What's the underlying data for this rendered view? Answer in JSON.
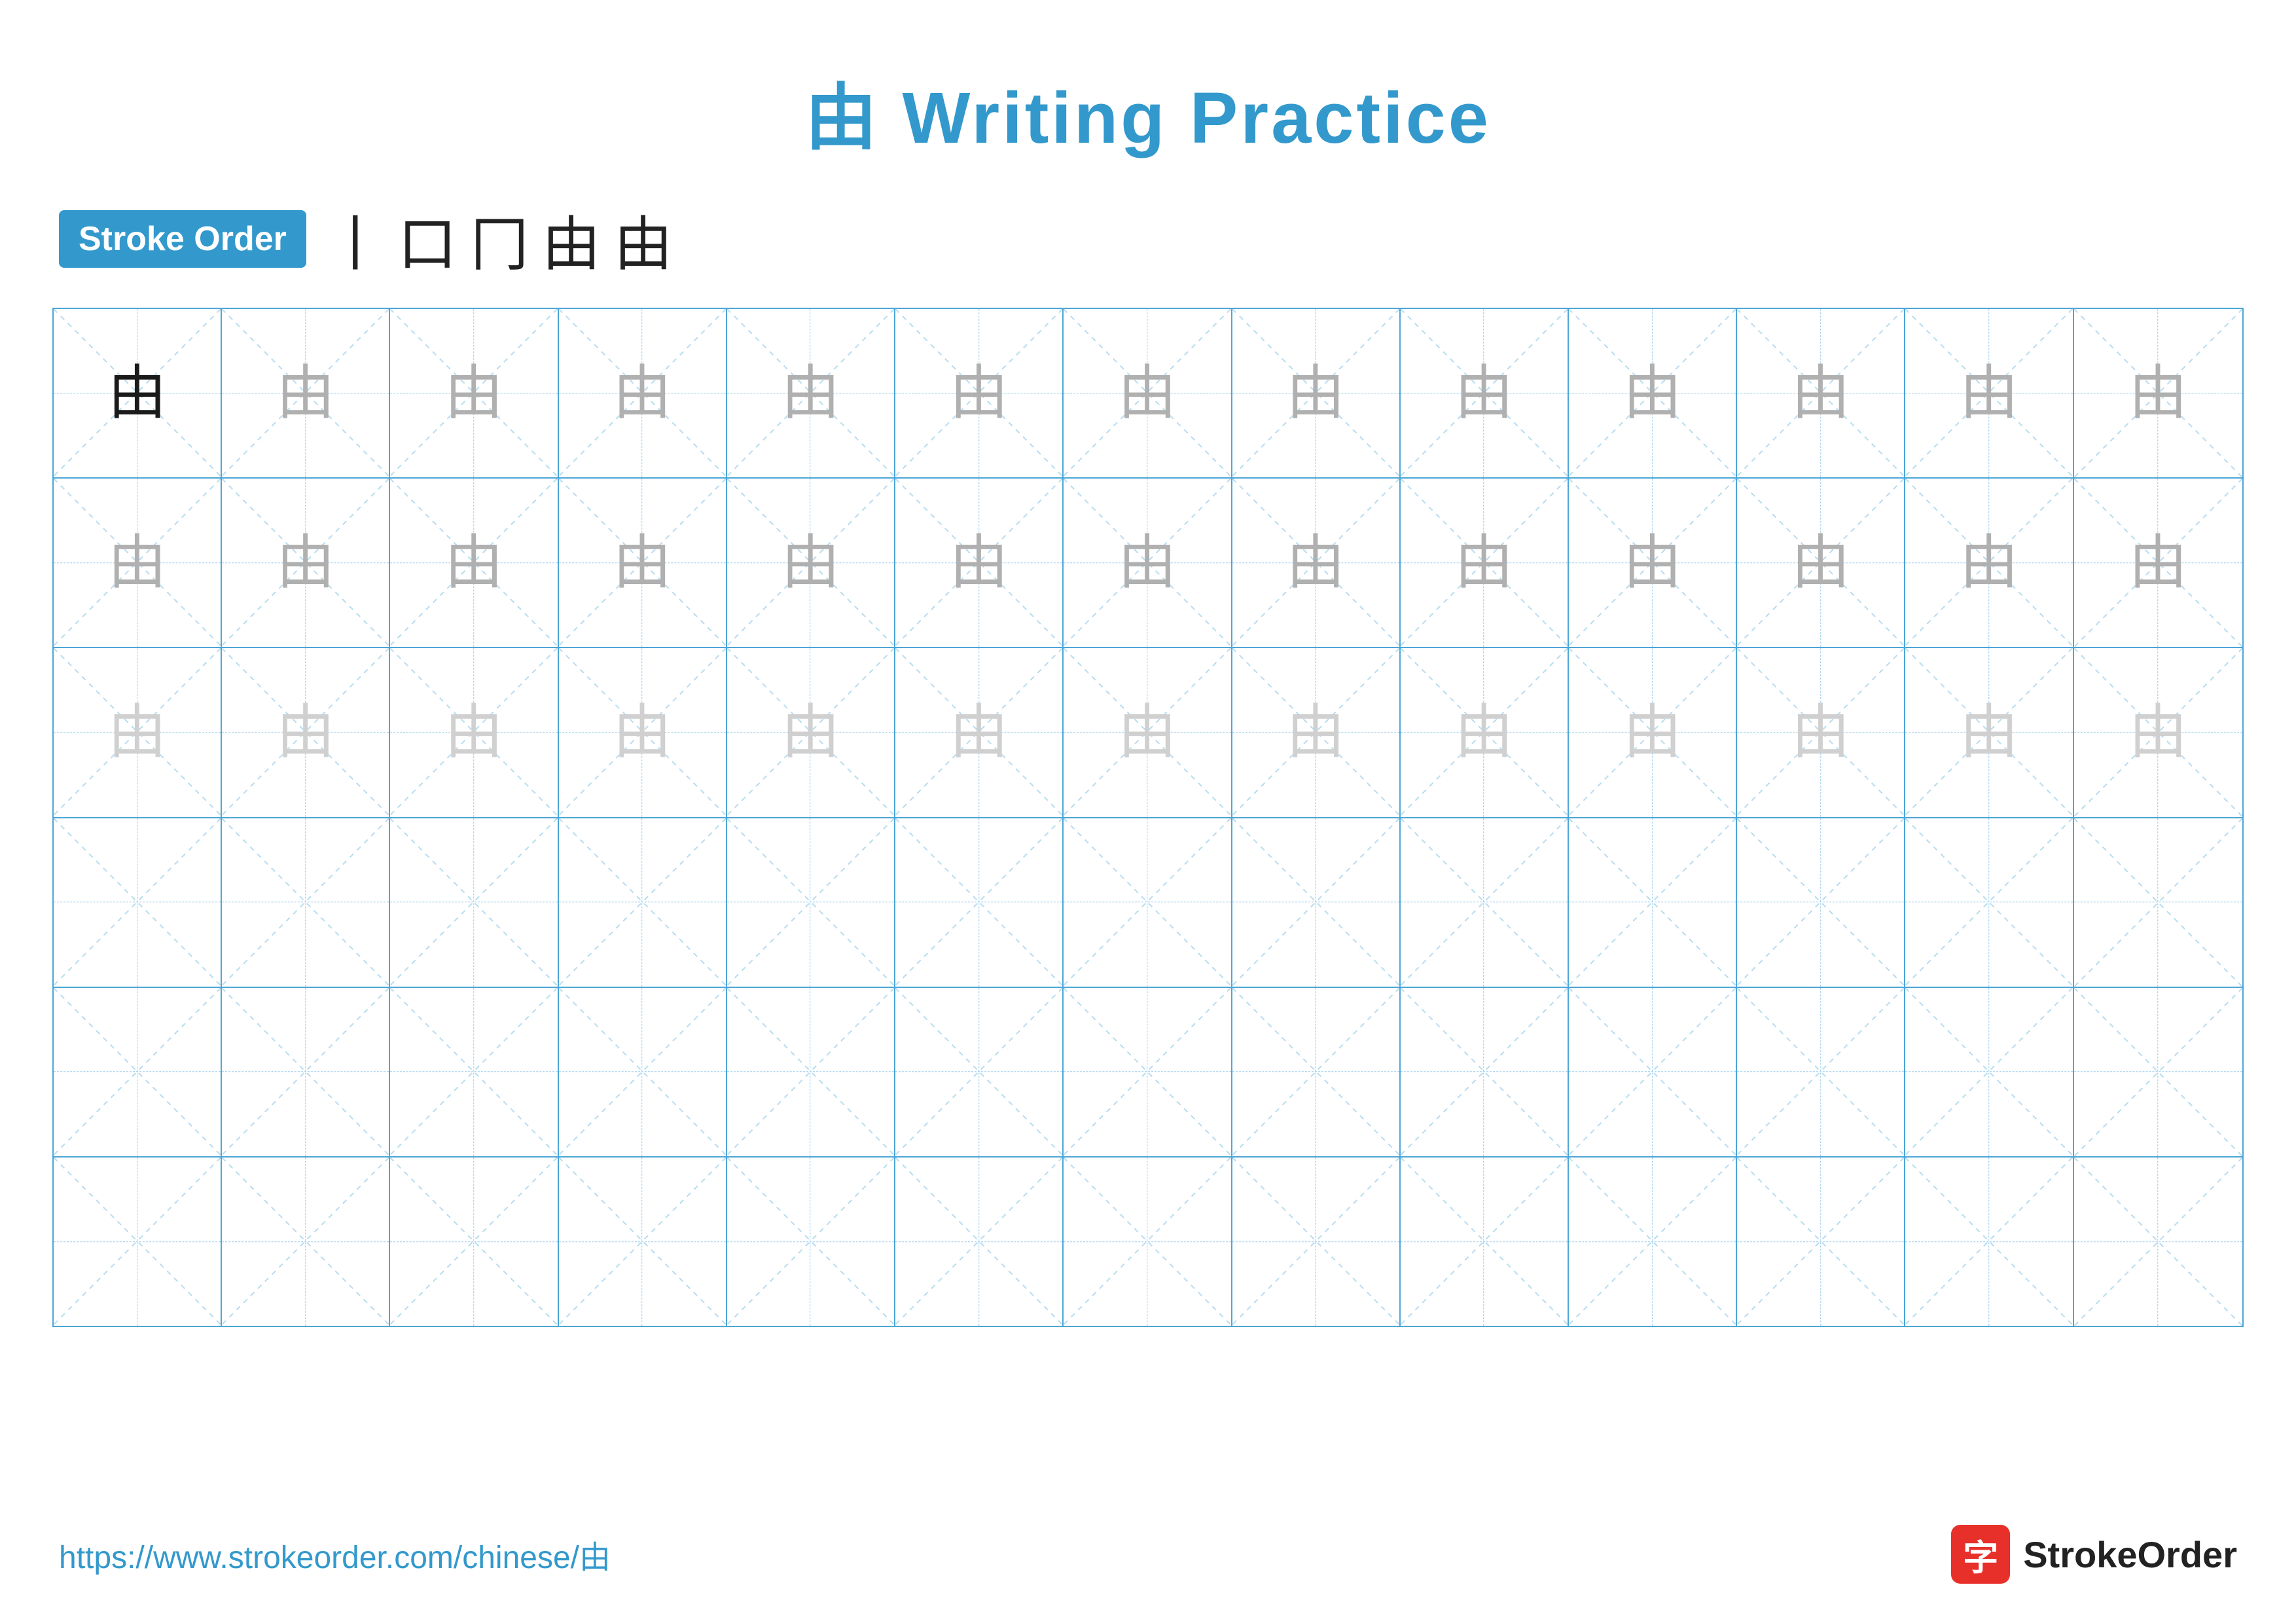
{
  "title": {
    "character": "由",
    "text": " Writing Practice",
    "full": "由 Writing Practice"
  },
  "stroke_order": {
    "badge_label": "Stroke Order",
    "steps": [
      "丨",
      "口",
      "冂",
      "由",
      "由"
    ]
  },
  "grid": {
    "rows": 6,
    "cols": 13,
    "character": "由",
    "row_styles": [
      [
        "dark",
        "medium",
        "medium",
        "medium",
        "medium",
        "medium",
        "medium",
        "medium",
        "medium",
        "medium",
        "medium",
        "medium",
        "medium"
      ],
      [
        "medium",
        "medium",
        "medium",
        "medium",
        "medium",
        "medium",
        "medium",
        "medium",
        "medium",
        "medium",
        "medium",
        "medium",
        "medium"
      ],
      [
        "light",
        "light",
        "light",
        "light",
        "light",
        "light",
        "light",
        "light",
        "light",
        "light",
        "light",
        "light",
        "light"
      ],
      [
        "empty",
        "empty",
        "empty",
        "empty",
        "empty",
        "empty",
        "empty",
        "empty",
        "empty",
        "empty",
        "empty",
        "empty",
        "empty"
      ],
      [
        "empty",
        "empty",
        "empty",
        "empty",
        "empty",
        "empty",
        "empty",
        "empty",
        "empty",
        "empty",
        "empty",
        "empty",
        "empty"
      ],
      [
        "empty",
        "empty",
        "empty",
        "empty",
        "empty",
        "empty",
        "empty",
        "empty",
        "empty",
        "empty",
        "empty",
        "empty",
        "empty"
      ]
    ]
  },
  "footer": {
    "url": "https://www.strokeorder.com/chinese/由",
    "brand": "StrokeOrder"
  }
}
